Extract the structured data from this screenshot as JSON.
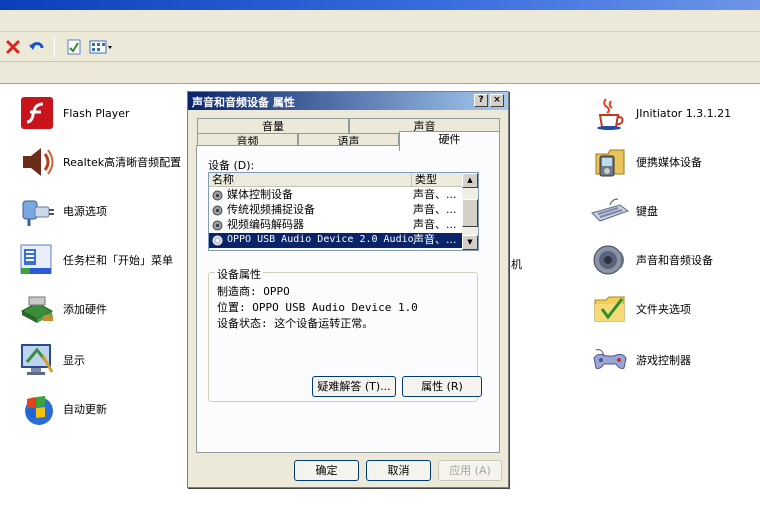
{
  "toolbar": {
    "icons": [
      "delete-icon",
      "undo-icon",
      "properties-icon",
      "views-icon"
    ]
  },
  "control_panel": {
    "left_items": [
      {
        "label": "Flash Player",
        "icon": "flash-player-icon"
      },
      {
        "label": "Realtek高清晰音频配置",
        "icon": "realtek-audio-icon"
      },
      {
        "label": "电源选项",
        "icon": "power-options-icon"
      },
      {
        "label": "任务栏和「开始」菜单",
        "icon": "taskbar-icon"
      },
      {
        "label": "添加硬件",
        "icon": "add-hardware-icon"
      },
      {
        "label": "显示",
        "icon": "display-icon"
      },
      {
        "label": "自动更新",
        "icon": "automatic-updates-icon"
      }
    ],
    "right_items": [
      {
        "label": "JInitiator 1.3.1.21",
        "icon": "java-icon"
      },
      {
        "label": "便携媒体设备",
        "icon": "portable-media-icon"
      },
      {
        "label": "键盘",
        "icon": "keyboard-icon"
      },
      {
        "label": "声音和音频设备",
        "icon": "speaker-icon"
      },
      {
        "label": "文件夹选项",
        "icon": "folder-options-icon"
      },
      {
        "label": "游戏控制器",
        "icon": "game-controller-icon"
      }
    ],
    "partial_label": "机"
  },
  "dialog": {
    "title": "声音和音频设备 属性",
    "help_button": "?",
    "close_button": "×",
    "tabs_back": [
      "音量",
      "声音"
    ],
    "tabs_front": [
      "音频",
      "语声",
      "硬件"
    ],
    "devices_label": "设备 (D):",
    "columns": [
      "名称",
      "类型"
    ],
    "devices": [
      {
        "name": "媒体控制设备",
        "type": "声音、..."
      },
      {
        "name": "传统视频捕捉设备",
        "type": "声音、..."
      },
      {
        "name": "视频编码解码器",
        "type": "声音、..."
      },
      {
        "name": "OPPO USB Audio Device 2.0 Audio",
        "type": "声音、..."
      }
    ],
    "properties_title": "设备属性",
    "manufacturer": "制造商: OPPO",
    "location": "位置: OPPO USB Audio Device 1.0",
    "status": "设备状态: 这个设备运转正常。",
    "troubleshoot_button": "疑难解答 (T)...",
    "properties_button": "属性 (R)",
    "ok_button": "确定",
    "cancel_button": "取消",
    "apply_button": "应用 (A)"
  }
}
